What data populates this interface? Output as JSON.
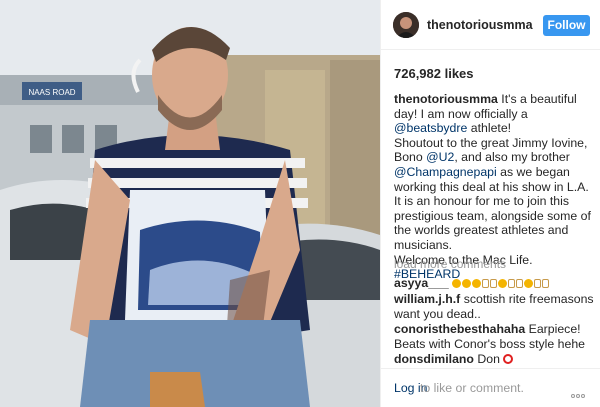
{
  "post": {
    "username": "thenotoriousmma",
    "follow_label": "Follow",
    "likes": "726,982 likes",
    "caption": {
      "username": "thenotoriousmma",
      "line1": "It's a beautiful day! I am now officially a ",
      "tag1": "@beatsbydre",
      "line2": " athlete!",
      "line3": "Shoutout to the great Jimmy Iovine, Bono ",
      "tag2": "@U2",
      "line4": ", and also my brother ",
      "tag3": "@Champagnepapi",
      "line5": " as we began working this deal at his show in L.A.",
      "line6": "It is an honour for me to join this prestigious team, alongside some of the worlds greatest athletes and musicians.",
      "line7": "Welcome to the Mac Life.",
      "hashtag": "#BEHEARD"
    },
    "load_more": "load more comments",
    "comments": [
      {
        "username": "asyya___",
        "text": ""
      },
      {
        "username": "william.j.h.f",
        "text": "scottish rite freemasons want you dead.."
      },
      {
        "username": "conoristhebesthahaha",
        "text": "Earpiece! Beats with Conor's boss style hehe"
      },
      {
        "username": "donsdimilano",
        "text": "Don"
      }
    ],
    "footer": {
      "login_label": "Log in",
      "prompt": "to like or comment."
    },
    "photo_sign": "NAAS ROAD",
    "colors": {
      "follow_blue": "#3897f0",
      "link_navy": "#003569",
      "muted_gray": "#999999"
    },
    "icons": [
      "avatar",
      "more-options-icon",
      "emoji-icon",
      "red-circle-icon"
    ]
  }
}
